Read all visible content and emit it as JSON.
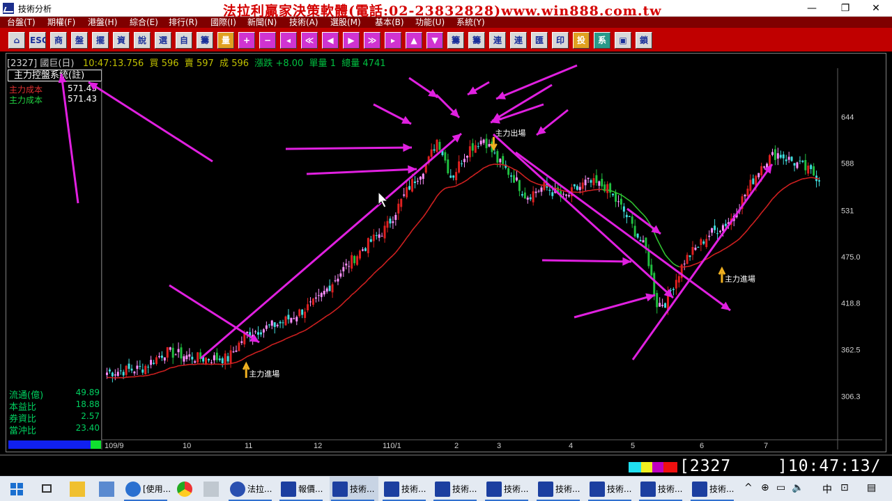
{
  "window": {
    "title": "技術分析",
    "banner": "法拉利贏家決策軟體(電話:02-23832828)www.win888.com.tw",
    "minimize": "—",
    "maximize": "❐",
    "close": "✕"
  },
  "menu": [
    "台盤(T)",
    "期權(F)",
    "港盤(H)",
    "綜合(E)",
    "排行(R)",
    "國際(I)",
    "新聞(N)",
    "技術(A)",
    "選股(M)",
    "基本(B)",
    "功能(U)",
    "系統(Y)"
  ],
  "toolbar": {
    "buttons": [
      "⌂",
      "ESC",
      "商",
      "盤",
      "擺",
      "資",
      "說",
      "選",
      "自",
      "籌",
      "量",
      "+",
      "−",
      "◂",
      "≪",
      "◀",
      "▶",
      "≫",
      "▸",
      "▲",
      "▼",
      "籌",
      "籌",
      "連",
      "連",
      "匯",
      "印",
      "投",
      "系",
      "▣",
      "鎖"
    ]
  },
  "quote": {
    "symbol": "[2327] 國巨(日)",
    "time": "10:47:13.756",
    "bid_label": "買",
    "bid": "596",
    "ask_label": "賣",
    "ask": "597",
    "deal_label": "成",
    "deal": "596",
    "change_label": "漲跌",
    "change": "+8.00",
    "unit_label": "單量",
    "unit": "1",
    "total_label": "總量",
    "total": "4741"
  },
  "side_panel": {
    "system_title": "主力控盤系統(註)",
    "cost_rows": [
      {
        "label": "主力成本",
        "value": "571.43",
        "color": "#e03030"
      },
      {
        "label": "主力成本",
        "value": "571.43",
        "color": "#20d040"
      }
    ],
    "stats": [
      {
        "label": "流通(億)",
        "value": "49.89"
      },
      {
        "label": "本益比",
        "value": "18.88"
      },
      {
        "label": "券資比",
        "value": "2.57"
      },
      {
        "label": "當沖比",
        "value": "23.40"
      }
    ]
  },
  "chart_data": {
    "type": "candlestick",
    "title": "",
    "y_ticks": [
      "644",
      "588",
      "531",
      "475.0",
      "418.8",
      "362.5",
      "306.3"
    ],
    "y_tick_values": [
      644,
      588,
      531,
      475.0,
      418.8,
      362.5,
      306.3
    ],
    "ylim": [
      256,
      700
    ],
    "x_ticks": [
      "109/9",
      "10",
      "11",
      "12",
      "110/1",
      "2",
      "3",
      "4",
      "5",
      "6",
      "7"
    ],
    "annotations": [
      {
        "text": "主力進場",
        "x_bar": 51,
        "price": 347,
        "dir": "up"
      },
      {
        "text": "主力出場",
        "x_bar": 141,
        "price": 608,
        "dir": "down"
      },
      {
        "text": "主力進場",
        "x_bar": 224,
        "price": 462,
        "dir": "up"
      }
    ],
    "grid": false,
    "colors": {
      "up": "#ff90ff",
      "down": "#40e0e0",
      "up_strong": "#e02020",
      "down_strong": "#20c040",
      "ma_bear": "#30c030",
      "ma_bull": "#d02020",
      "arrows": "#e020e0"
    }
  },
  "status": {
    "code": "[2327",
    "time": "]10:47:13/"
  },
  "taskbar": {
    "items": [
      "[使用...",
      "法拉...",
      "報價...",
      "技術...",
      "技術...",
      "技術...",
      "技術...",
      "技術...",
      "技術...",
      "技術...",
      "技術..."
    ],
    "tray": [
      "^",
      "⊕",
      "▭",
      "🔈",
      "中",
      "⊡",
      "▤"
    ]
  }
}
